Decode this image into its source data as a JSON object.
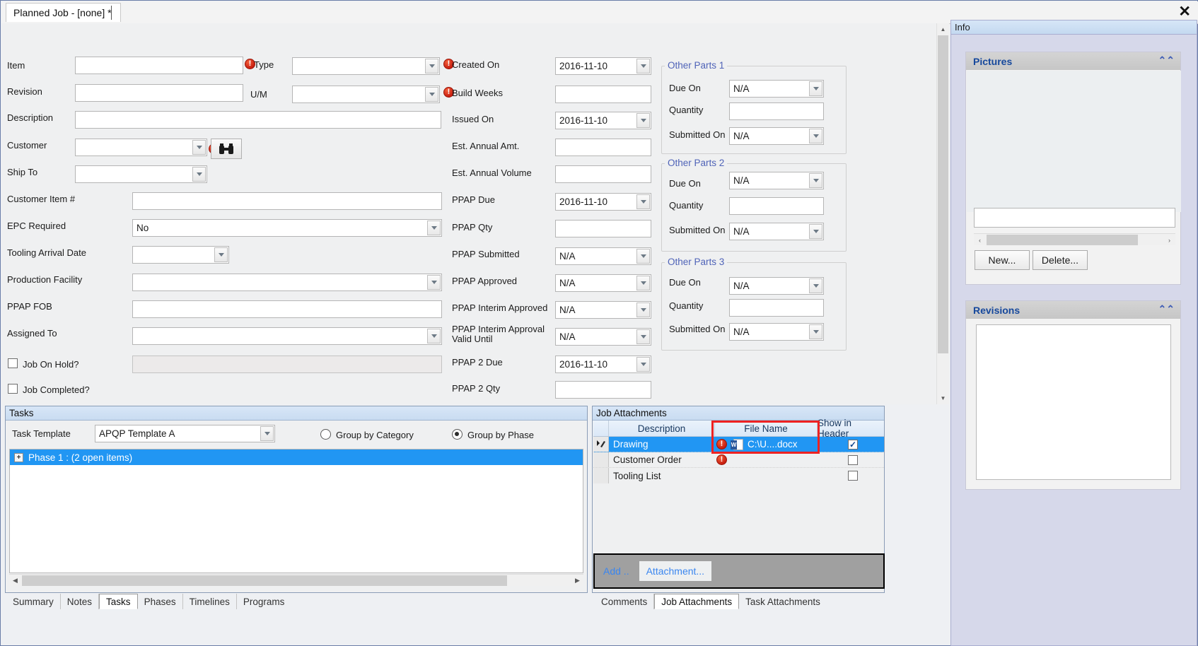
{
  "window": {
    "tab_title": "Planned Job - [none] *",
    "close_label": "✕"
  },
  "form": {
    "left_fields": [
      {
        "label": "Item",
        "value": "",
        "type": "text"
      },
      {
        "label": "Revision",
        "value": "",
        "type": "text"
      },
      {
        "label": "Description",
        "value": "",
        "type": "text"
      },
      {
        "label": "Customer",
        "value": "",
        "type": "combo"
      },
      {
        "label": "Ship To",
        "value": "",
        "type": "combo"
      },
      {
        "label": "Customer Item #",
        "value": "",
        "type": "text"
      },
      {
        "label": "EPC Required",
        "value": "No",
        "type": "combo"
      },
      {
        "label": "Tooling Arrival Date",
        "value": "",
        "type": "combo"
      },
      {
        "label": "Production Facility",
        "value": "",
        "type": "combo"
      },
      {
        "label": "PPAP FOB",
        "value": "",
        "type": "text"
      },
      {
        "label": "Assigned To",
        "value": "",
        "type": "combo"
      }
    ],
    "inline_fields": [
      {
        "label": "Type",
        "value": "",
        "type": "combo"
      },
      {
        "label": "U/M",
        "value": "",
        "type": "combo"
      }
    ],
    "checkboxes": [
      {
        "label": "Job On Hold?",
        "checked": false
      },
      {
        "label": "Job Completed?",
        "checked": false
      }
    ],
    "middle_fields": [
      {
        "label": "Created On",
        "value": "2016-11-10",
        "type": "combo"
      },
      {
        "label": "Build Weeks",
        "value": "",
        "type": "text"
      },
      {
        "label": "Issued On",
        "value": "2016-11-10",
        "type": "combo"
      },
      {
        "label": "Est. Annual Amt.",
        "value": "",
        "type": "text"
      },
      {
        "label": "Est. Annual Volume",
        "value": "",
        "type": "text"
      },
      {
        "label": "PPAP Due",
        "value": "2016-11-10",
        "type": "combo"
      },
      {
        "label": "PPAP Qty",
        "value": "",
        "type": "text"
      },
      {
        "label": "PPAP Submitted",
        "value": "N/A",
        "type": "combo"
      },
      {
        "label": "PPAP Approved",
        "value": "N/A",
        "type": "combo"
      },
      {
        "label": "PPAP Interim Approved",
        "value": "N/A",
        "type": "combo"
      },
      {
        "label": "PPAP Interim Approval Valid Until",
        "value": "N/A",
        "type": "combo"
      },
      {
        "label": "PPAP 2 Due",
        "value": "2016-11-10",
        "type": "combo"
      },
      {
        "label": "PPAP 2 Qty",
        "value": "",
        "type": "text"
      }
    ],
    "other_parts": [
      {
        "title": "Other Parts 1",
        "fields": [
          {
            "label": "Due On",
            "value": "N/A",
            "type": "combo"
          },
          {
            "label": "Quantity",
            "value": "",
            "type": "text"
          },
          {
            "label": "Submitted On",
            "value": "N/A",
            "type": "combo"
          }
        ]
      },
      {
        "title": "Other Parts 2",
        "fields": [
          {
            "label": "Due On",
            "value": "N/A",
            "type": "combo"
          },
          {
            "label": "Quantity",
            "value": "",
            "type": "text"
          },
          {
            "label": "Submitted On",
            "value": "N/A",
            "type": "combo"
          }
        ]
      },
      {
        "title": "Other Parts 3",
        "fields": [
          {
            "label": "Due On",
            "value": "N/A",
            "type": "combo"
          },
          {
            "label": "Quantity",
            "value": "",
            "type": "text"
          },
          {
            "label": "Submitted On",
            "value": "N/A",
            "type": "combo"
          }
        ]
      }
    ]
  },
  "tasks": {
    "caption": "Tasks",
    "template_label": "Task Template",
    "template_value": "APQP Template A",
    "group_by_category": "Group by Category",
    "group_by_phase": "Group by Phase",
    "selected_grouping": "phase",
    "rows": [
      {
        "label": "Phase 1 : (2 open items)",
        "expander": "+",
        "selected": true
      }
    ],
    "tabs": [
      {
        "label": "Summary",
        "active": false
      },
      {
        "label": "Notes",
        "active": false
      },
      {
        "label": "Tasks",
        "active": true
      },
      {
        "label": "Phases",
        "active": false
      },
      {
        "label": "Timelines",
        "active": false
      },
      {
        "label": "Programs",
        "active": false
      }
    ]
  },
  "attachments": {
    "caption": "Job Attachments",
    "columns": [
      "Description",
      "File Name",
      "Show in Header"
    ],
    "rows": [
      {
        "description": "Drawing",
        "file_name": "C:\\U....docx",
        "warn": true,
        "file_icon": "word-document-icon",
        "show_in_header": true,
        "selected": true
      },
      {
        "description": "Customer Order",
        "file_name": "",
        "warn": true,
        "file_icon": "",
        "show_in_header": false,
        "selected": false
      },
      {
        "description": "Tooling List",
        "file_name": "",
        "warn": false,
        "file_icon": "",
        "show_in_header": false,
        "selected": false
      }
    ],
    "toolbar": {
      "add_label": "Add ..",
      "attachment_label": "Attachment..."
    },
    "tabs": [
      {
        "label": "Comments",
        "active": false
      },
      {
        "label": "Job Attachments",
        "active": true
      },
      {
        "label": "Task Attachments",
        "active": false
      }
    ],
    "highlight_color": "#ee2222"
  },
  "info": {
    "caption": "Info",
    "pictures": {
      "title": "Pictures",
      "caption_value": "",
      "new_label": "New...",
      "delete_label": "Delete...",
      "scroll_left": "‹",
      "scroll_right": "›",
      "collapse_icon": "chevron-up-double"
    },
    "revisions": {
      "title": "Revisions",
      "collapse_icon": "chevron-up-double"
    }
  },
  "colors": {
    "accent_blue": "#2196f3",
    "group_title": "#4f63b8",
    "panel_title": "#16489c",
    "warn_red": "#c81f10",
    "link_blue": "#3a86f0"
  }
}
